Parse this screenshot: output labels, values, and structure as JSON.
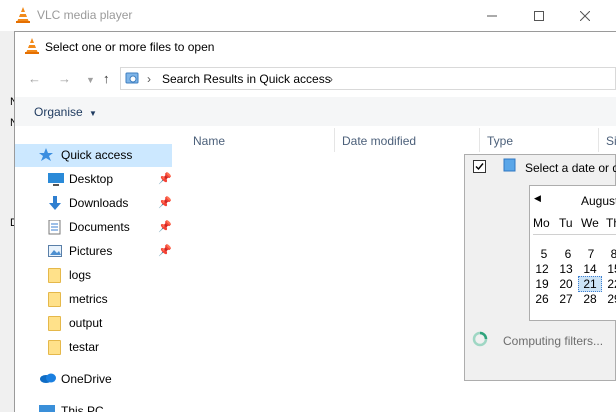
{
  "vlc_window": {
    "title": "VLC media player"
  },
  "dialog": {
    "title": "Select one or more files to open",
    "address": {
      "path": "Search Results in Quick access"
    },
    "toolbar": {
      "organise_label": "Organise"
    },
    "sidebar": {
      "items": [
        {
          "label": "Quick access",
          "icon": "star-icon",
          "pinned": false
        },
        {
          "label": "Desktop",
          "icon": "desktop-icon",
          "pinned": true
        },
        {
          "label": "Downloads",
          "icon": "download-arrow-icon",
          "pinned": true
        },
        {
          "label": "Documents",
          "icon": "documents-icon",
          "pinned": true
        },
        {
          "label": "Pictures",
          "icon": "pictures-icon",
          "pinned": true
        },
        {
          "label": "logs",
          "icon": "folder-icon",
          "pinned": false
        },
        {
          "label": "metrics",
          "icon": "folder-icon",
          "pinned": false
        },
        {
          "label": "output",
          "icon": "folder-icon",
          "pinned": false
        },
        {
          "label": "testar",
          "icon": "folder-icon",
          "pinned": false
        },
        {
          "label": "OneDrive",
          "icon": "cloud-icon",
          "pinned": false
        },
        {
          "label": "This PC",
          "icon": "computer-icon",
          "pinned": false
        }
      ]
    },
    "columns": [
      "Name",
      "Date modified",
      "Type",
      "Si"
    ],
    "date_popup": {
      "checkbox_label": "Select a date or d",
      "month": "August",
      "weekdays": [
        "Mo",
        "Tu",
        "We",
        "Th"
      ],
      "weeks": [
        [
          "5",
          "6",
          "7",
          "8"
        ],
        [
          "12",
          "13",
          "14",
          "15"
        ],
        [
          "19",
          "20",
          "21",
          "22"
        ],
        [
          "26",
          "27",
          "28",
          "29"
        ]
      ],
      "today": "21",
      "status": "Computing filters..."
    }
  },
  "colors": {
    "selection": "#cce8ff",
    "accent": "#0078d7"
  }
}
